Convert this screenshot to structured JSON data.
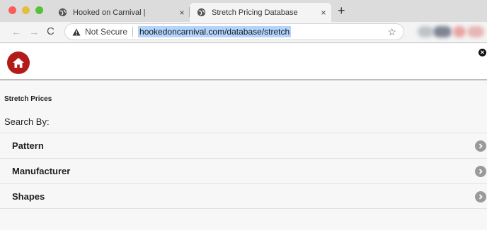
{
  "browser": {
    "tabs": [
      {
        "title": "Hooked on Carnival |",
        "close": "×"
      },
      {
        "title": "Stretch Pricing Database",
        "close": "×"
      }
    ],
    "new_tab": "+",
    "nav": {
      "back": "←",
      "forward": "→",
      "reload": "C"
    },
    "address": {
      "security": "Not Secure",
      "url": "hookedoncarnival.com/database/stretch",
      "star": "☆"
    }
  },
  "page": {
    "title": "Stretch Prices",
    "search_by_label": "Search By:",
    "menu_items": [
      "Pattern",
      "Manufacturer",
      "Shapes"
    ],
    "colors": {
      "home_button": "#b31b1b",
      "chevron": "#9a9a9a"
    }
  }
}
